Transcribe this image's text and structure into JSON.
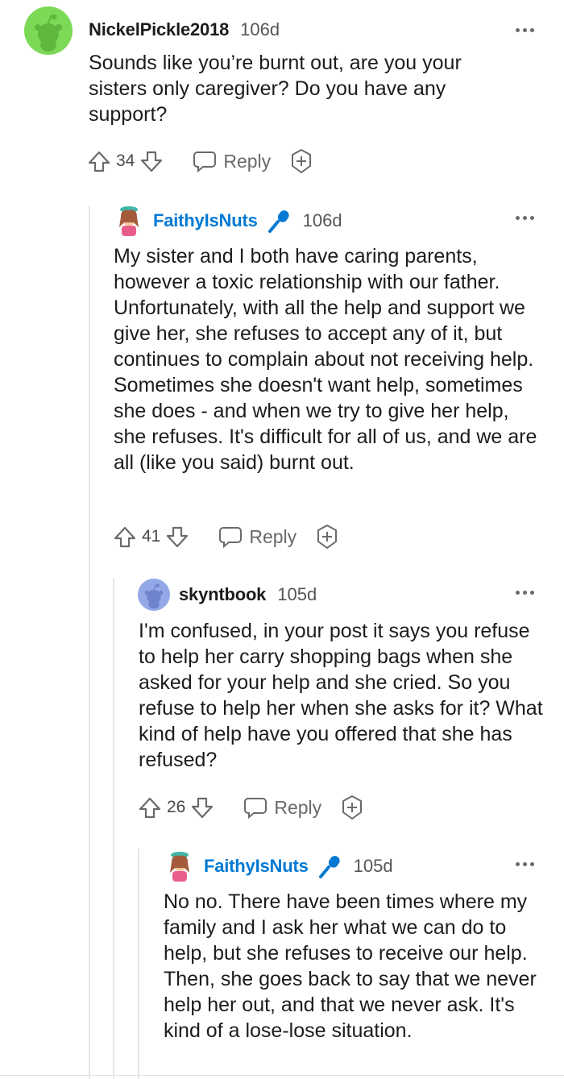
{
  "comments": [
    {
      "username": "NickelPickle2018",
      "age": "106d",
      "text": "Sounds like you’re burnt out, are you your sisters only caregiver? Do you have any support?",
      "score": "34",
      "reply_label": "Reply",
      "avatar_color": "#7bd956",
      "avatar_icon": "snoo-avatar-icon"
    },
    {
      "username": "FaithyIsNuts",
      "age": "106d",
      "op_badge_icon": "microphone-icon",
      "text": "My sister and I both have caring parents, however a toxic relationship with our father. Unfortunately, with all the help and support we give her, she refuses to accept any of it, but continues to complain about not receiving help. Sometimes she doesn't want help, sometimes she does - and when we try to give her help, she refuses. It's difficult for all of us, and we are all (like you said) burnt out.",
      "score": "41",
      "reply_label": "Reply",
      "accent_color": "#0079d3"
    },
    {
      "username": "skyntbook",
      "age": "105d",
      "text": "I'm confused, in your post it says you refuse to help her carry shopping bags when she asked for your help and she cried. So you refuse to help her when she asks for it? What kind of help have you offered that she has refused?",
      "score": "26",
      "reply_label": "Reply",
      "avatar_color": "#94a8e8",
      "avatar_icon": "snoo-avatar-icon"
    },
    {
      "username": "FaithyIsNuts",
      "age": "105d",
      "op_badge_icon": "microphone-icon",
      "text": "No no. There have been times where my family and I ask her what we can do to help, but she refuses to receive our help. Then, she goes back to say that we never help her out, and that we never ask. It's kind of a lose-lose situation.",
      "accent_color": "#0079d3"
    }
  ]
}
